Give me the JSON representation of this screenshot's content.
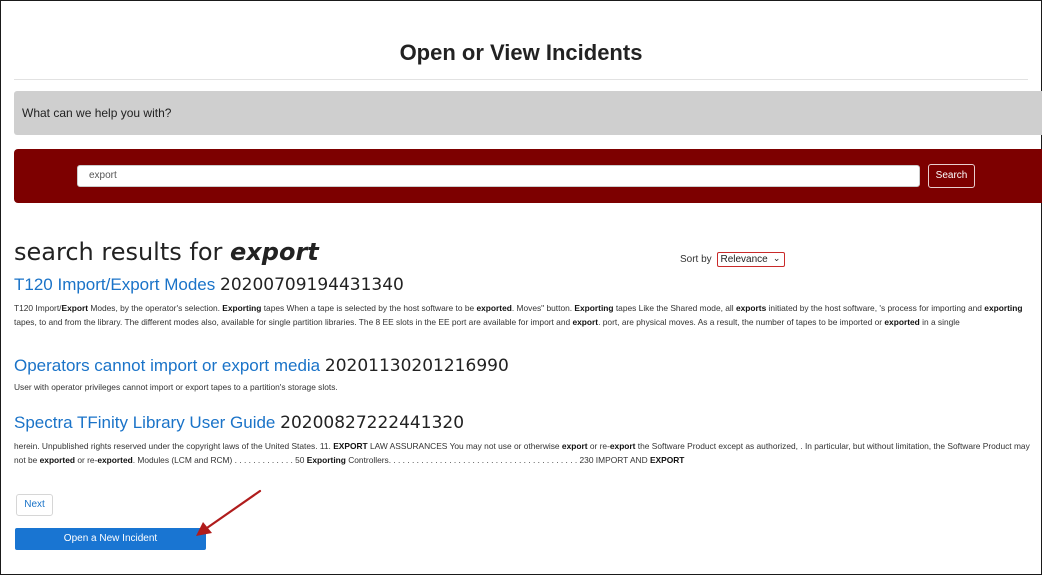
{
  "page": {
    "title": "Open or View Incidents"
  },
  "help": {
    "prompt": "What can we help you with?"
  },
  "search": {
    "query": "export",
    "button_label": "Search"
  },
  "results": {
    "heading_prefix": "search results for",
    "heading_term": "export",
    "sort_label": "Sort by",
    "sort_value": "Relevance",
    "items": [
      {
        "title": "T120 Import/Export Modes",
        "id": "20200709194431340",
        "snippet": [
          {
            "t": "T120 Import/"
          },
          {
            "t": "Export",
            "b": true
          },
          {
            "t": " Modes, by the operator's selection. "
          },
          {
            "t": "Exporting",
            "b": true
          },
          {
            "t": " tapes When a tape is selected by the host software to be "
          },
          {
            "t": "exported",
            "b": true
          },
          {
            "t": ". Moves\" button. "
          },
          {
            "t": "Exporting",
            "b": true
          },
          {
            "t": " tapes Like the Shared mode, all "
          },
          {
            "t": "exports",
            "b": true
          },
          {
            "t": " initiated by the host software, 's process for importing and "
          },
          {
            "t": "exporting",
            "b": true
          },
          {
            "t": " tapes, to and from the library. The different modes also, available for single partition libraries. The 8 EE slots in the EE port are available for import and "
          },
          {
            "t": "export",
            "b": true
          },
          {
            "t": ". port, are physical moves. As a result, the number of tapes to be imported or "
          },
          {
            "t": "exported",
            "b": true
          },
          {
            "t": " in a single"
          }
        ]
      },
      {
        "title": "Operators cannot import or export media",
        "id": "20201130201216990",
        "snippet": [
          {
            "t": "User with operator privileges cannot import or export tapes to a partition's storage slots."
          }
        ]
      },
      {
        "title": "Spectra TFinity Library User Guide",
        "id": "20200827222441320",
        "snippet": [
          {
            "t": "herein. Unpublished rights reserved under the copyright laws of the United States. 11. "
          },
          {
            "t": "EXPORT",
            "b": true
          },
          {
            "t": " LAW ASSURANCES You may not use or otherwise "
          },
          {
            "t": "export",
            "b": true
          },
          {
            "t": " or re-"
          },
          {
            "t": "export",
            "b": true
          },
          {
            "t": " the Software Product except as authorized, . In particular, but without limitation, the Software Product may not be "
          },
          {
            "t": "exported",
            "b": true
          },
          {
            "t": " or re-"
          },
          {
            "t": "exported",
            "b": true
          },
          {
            "t": ". Modules (LCM and RCM) . . . . . . . . . . . . . 50 "
          },
          {
            "t": "Exporting",
            "b": true
          },
          {
            "t": " Controllers. . . . . . . . . . . . . . . . . . . . . . . . . . . . . . . . . . . . . . . . . 230 IMPORT AND "
          },
          {
            "t": "EXPORT",
            "b": true
          }
        ]
      }
    ]
  },
  "pagination": {
    "next_label": "Next"
  },
  "actions": {
    "new_incident_label": "Open a New Incident"
  },
  "colors": {
    "accent": "#7d0000",
    "link": "#1a73c8",
    "primary_button": "#1975d2",
    "annotation_arrow": "#b01c1c"
  }
}
